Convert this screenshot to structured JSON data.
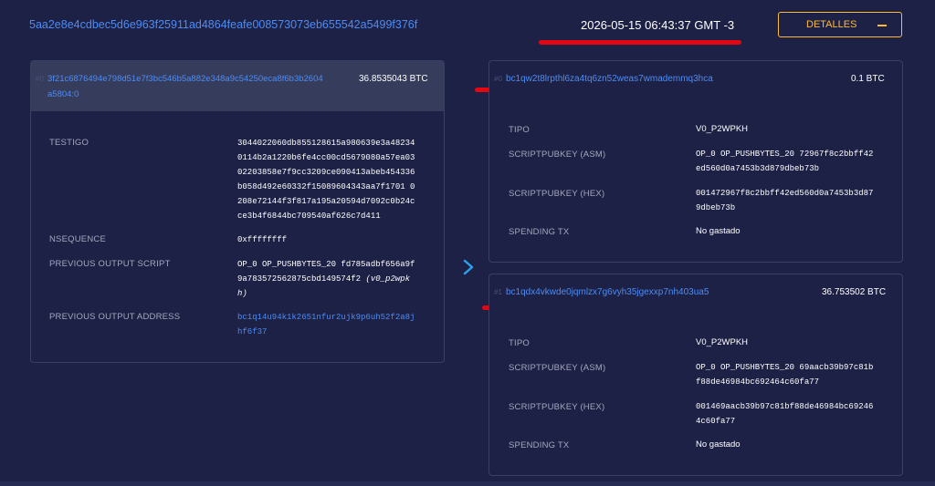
{
  "header": {
    "txid": "5aa2e8e4cdbec5d6e963f25911ad4864feafe008573073eb655542a5499f376f",
    "datetime": "2026-05-15 06:43:37 GMT -3",
    "details_button": "DETALLES"
  },
  "input": {
    "index": "#0",
    "prev_txid": "3f21c6876494e798d51e7f3bc546b5a882e348a9c54250eca8f6b3b2604",
    "prev_txid_tail": "a5804:0",
    "amount": "36.8535043 BTC",
    "rows": {
      "witness_label": "TESTIGO",
      "witness_lines": [
        "3044022060db855128615a980639e3a48234",
        "0114b2a1220b6fe4cc00cd5679080a57ea03",
        "02203858e7f9cc3209ce090413abeb454336",
        "b058d492e60332f15089604343aa7f1701 0",
        "208e72144f3f817a195a20594d7092c0b24c",
        "ce3b4f6844bc709540af626c7d411"
      ],
      "nsequence_label": "NSEQUENCE",
      "nsequence_value": "0xffffffff",
      "prev_script_label": "PREVIOUS OUTPUT SCRIPT",
      "prev_script_line1": "OP_0 OP_PUSHBYTES_20 fd785adbf656a9f",
      "prev_script_line2": "9a783572562875cbd149574f2",
      "prev_script_type1": "(v0_p2wpk",
      "prev_script_type2": "h)",
      "prev_address_label": "PREVIOUS OUTPUT ADDRESS",
      "prev_address_line1": "bc1q14u94k1k2651nfur2ujk9p6uh52f2a8j",
      "prev_address_line2": "hf6f37"
    }
  },
  "outputs": [
    {
      "index": "#0",
      "address": "bc1qw2t8lrpthl6za4tq6zn52weas7wmademmq3hca",
      "amount": "0.1 BTC",
      "type_label": "TIPO",
      "type_value": "V0_P2WPKH",
      "asm_label": "SCRIPTPUBKEY (ASM)",
      "asm_line1": "OP_0 OP_PUSHBYTES_20 72967f8c2bbff42",
      "asm_line2": "ed560d0a7453b3d879dbeb73b",
      "hex_label": "SCRIPTPUBKEY (HEX)",
      "hex_line1": "001472967f8c2bbff42ed560d0a7453b3d87",
      "hex_line2": "9dbeb73b",
      "spending_label": "SPENDING TX",
      "spending_value": "No gastado"
    },
    {
      "index": "#1",
      "address": "bc1qdx4vkwde0jqmlzx7g6vyh35jgexxp7nh403ua5",
      "amount": "36.753502 BTC",
      "type_label": "TIPO",
      "type_value": "V0_P2WPKH",
      "asm_label": "SCRIPTPUBKEY (ASM)",
      "asm_line1": "OP_0 OP_PUSHBYTES_20 69aacb39b97c81b",
      "asm_line2": "f88de46984bc692464c60fa77",
      "hex_label": "SCRIPTPUBKEY (HEX)",
      "hex_line1": "001469aacb39b97c81bf88de46984bc69246",
      "hex_line2": "4c60fa77",
      "spending_label": "SPENDING TX",
      "spending_value": "No gastado"
    }
  ],
  "colors": {
    "background": "#1d2145",
    "link": "#4d8cf5",
    "accent": "#ffb93b",
    "annotation": "#e30613"
  },
  "icons": {
    "details_toggle": "minus-icon",
    "flow_arrow": "chevron-right-icon"
  }
}
